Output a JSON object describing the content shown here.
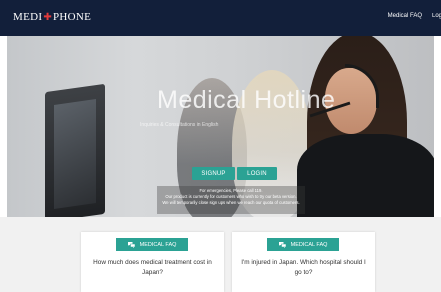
{
  "navbar": {
    "logo_left": "MEDI",
    "logo_cross": "✚",
    "logo_right": "PHONE",
    "links": [
      "Medical FAQ",
      "Login"
    ]
  },
  "hero": {
    "title": "Medical Hotline",
    "subtitle": "Inquiries & Consultations in English",
    "signup_label": "SIGNUP",
    "login_label": "LOGIN",
    "notice_lines": [
      "For emergencies, Please call 119.",
      "Our product is currently for customers who wish to try our beta version.",
      "We will temporarily close sign ups when we reach our quota of customers."
    ]
  },
  "faq_cards": [
    {
      "button_label": "MEDICAL FAQ",
      "question": "How much does medical treatment cost in Japan?"
    },
    {
      "button_label": "MEDICAL FAQ",
      "question": "I'm injured in Japan. Which hospital should I go to?"
    }
  ],
  "colors": {
    "navbar": "#121f3a",
    "accent": "#2ba294",
    "logo_cross": "#e23a3a"
  }
}
